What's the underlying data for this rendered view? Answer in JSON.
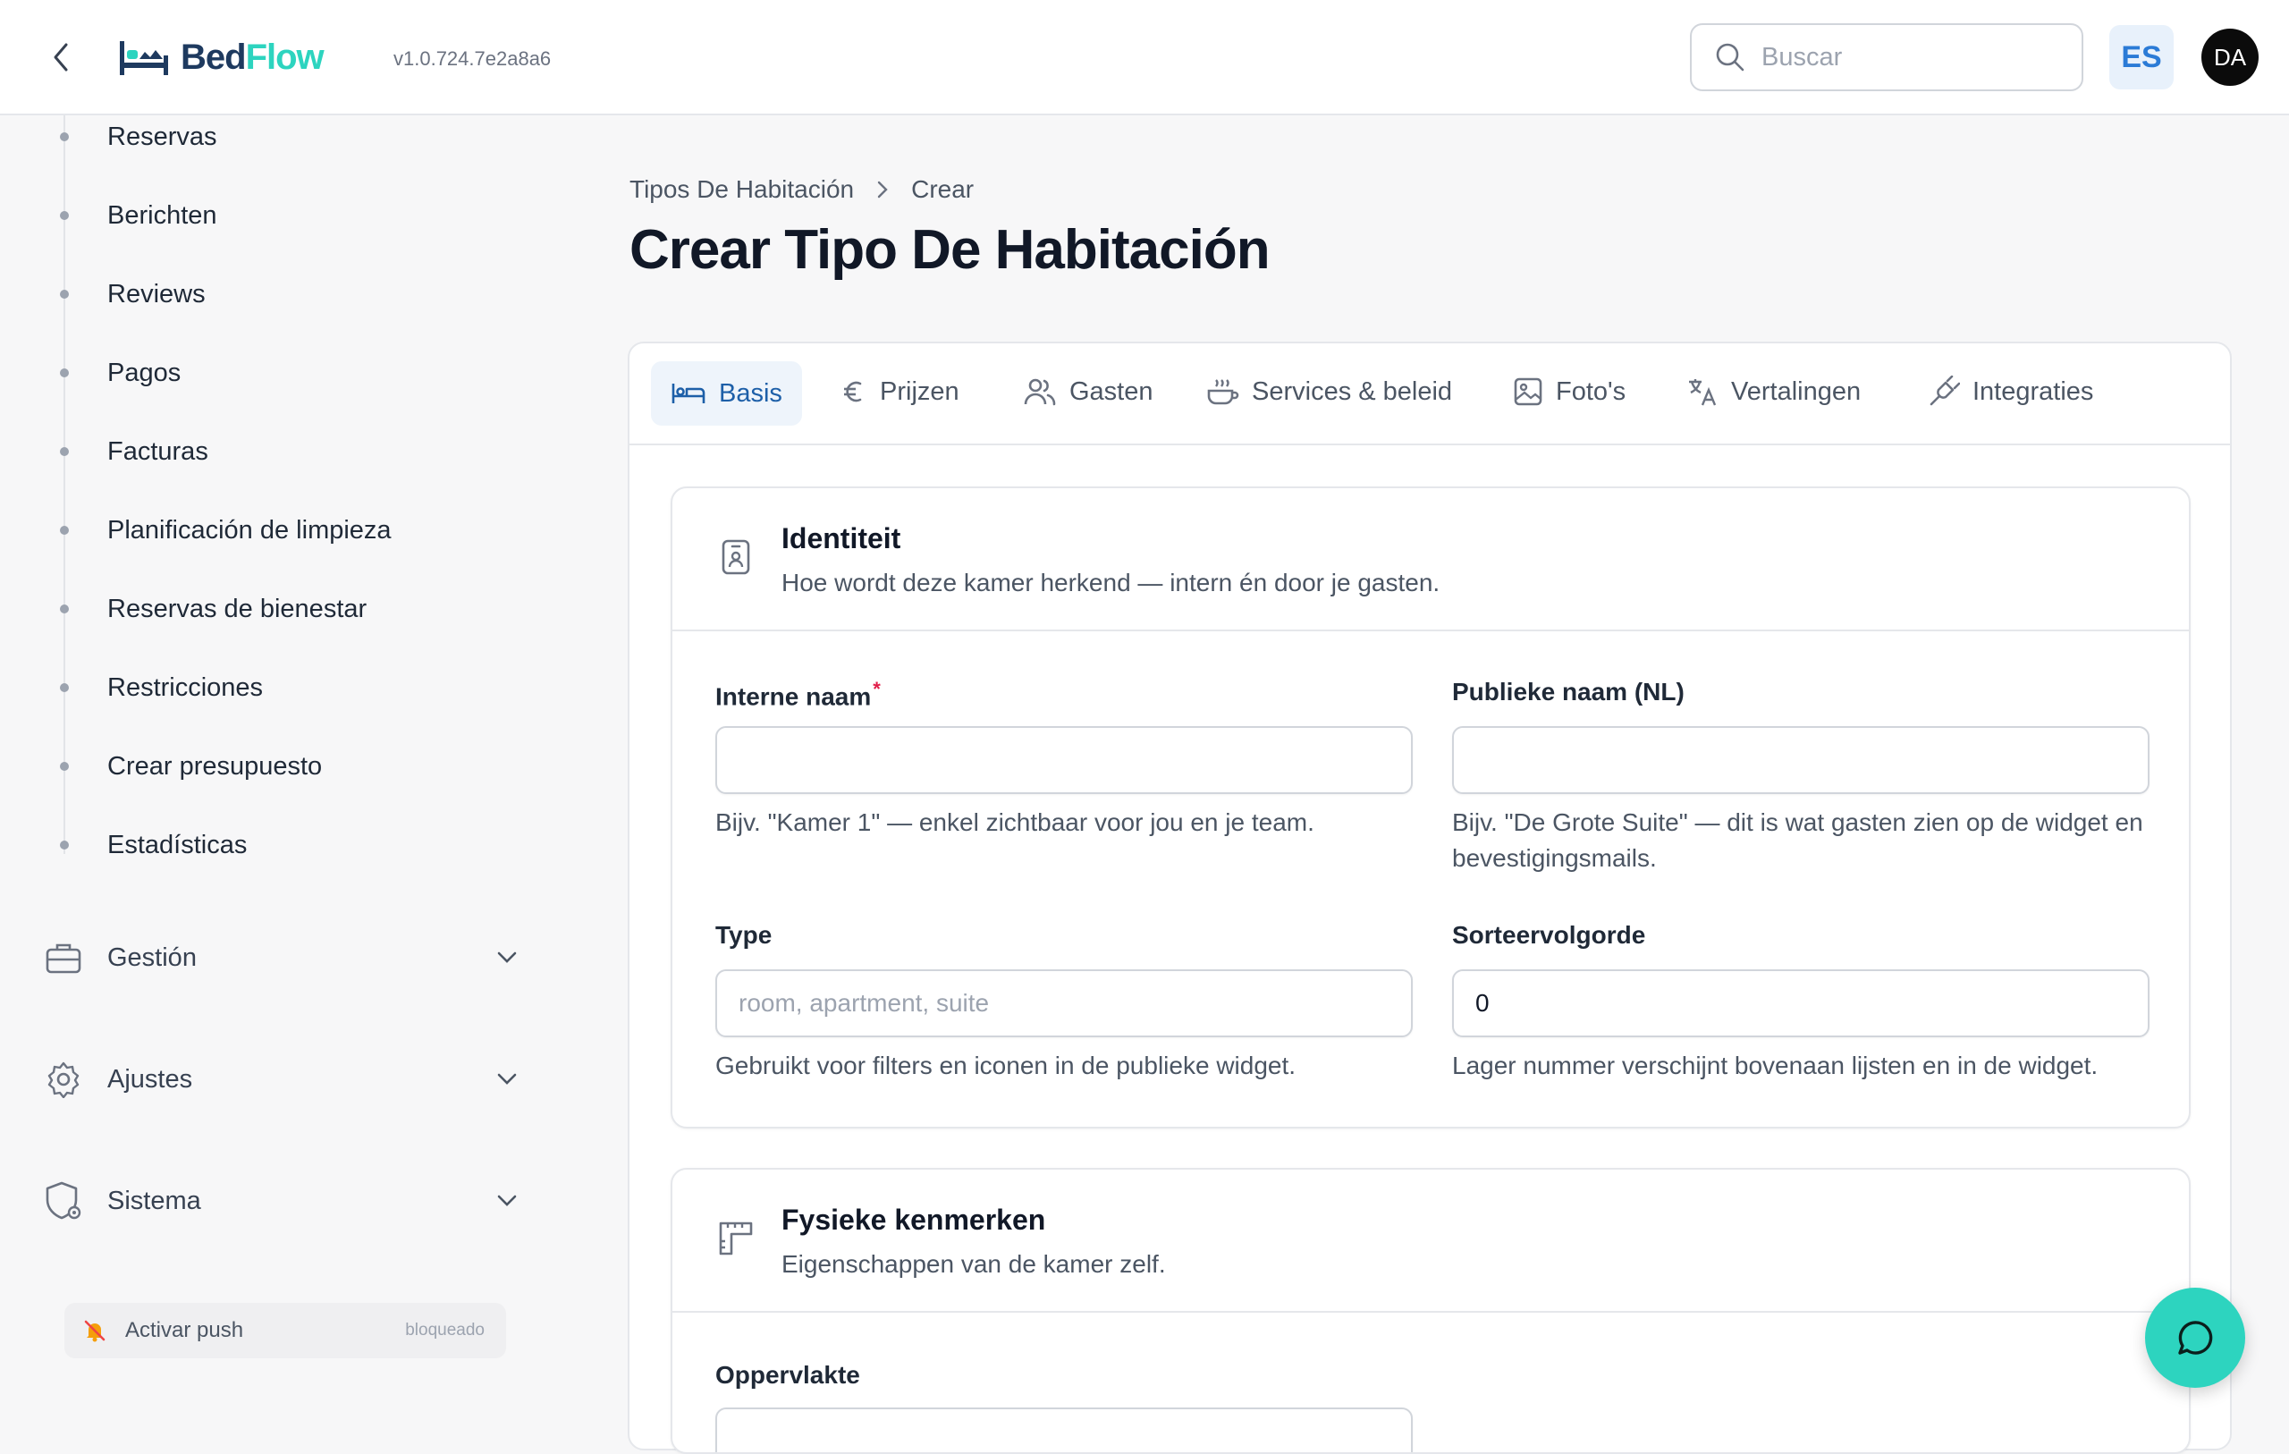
{
  "header": {
    "logo": {
      "part1": "Bed",
      "part2": "Flow"
    },
    "version": "v1.0.724.7e2a8a6",
    "search_placeholder": "Buscar",
    "language": "ES",
    "avatar_initials": "DA"
  },
  "sidebar": {
    "items": [
      {
        "label": "Reservas"
      },
      {
        "label": "Berichten"
      },
      {
        "label": "Reviews"
      },
      {
        "label": "Pagos"
      },
      {
        "label": "Facturas"
      },
      {
        "label": "Planificación de limpieza"
      },
      {
        "label": "Reservas de bienestar"
      },
      {
        "label": "Restricciones"
      },
      {
        "label": "Crear presupuesto"
      },
      {
        "label": "Estadísticas"
      }
    ],
    "groups": [
      {
        "label": "Gestión",
        "icon": "briefcase-icon"
      },
      {
        "label": "Ajustes",
        "icon": "gear-icon"
      },
      {
        "label": "Sistema",
        "icon": "shield-gear-icon"
      }
    ],
    "push": {
      "label": "Activar push",
      "status": "bloqueado"
    }
  },
  "breadcrumb": {
    "parent": "Tipos De Habitación",
    "current": "Crear"
  },
  "page_title": "Crear Tipo De Habitación",
  "tabs": [
    {
      "label": "Basis",
      "icon": "bed-icon",
      "active": true
    },
    {
      "label": "Prijzen",
      "icon": "euro-icon"
    },
    {
      "label": "Gasten",
      "icon": "users-icon"
    },
    {
      "label": "Services & beleid",
      "icon": "coffee-icon"
    },
    {
      "label": "Foto's",
      "icon": "image-icon"
    },
    {
      "label": "Vertalingen",
      "icon": "translate-icon"
    },
    {
      "label": "Integraties",
      "icon": "plug-icon"
    }
  ],
  "identity": {
    "title": "Identiteit",
    "description": "Hoe wordt deze kamer herkend — intern én door je gasten.",
    "internal_name": {
      "label": "Interne naam",
      "required_mark": "*",
      "value": "",
      "help": "Bijv. \"Kamer 1\" — enkel zichtbaar voor jou en je team."
    },
    "public_name": {
      "label": "Publieke naam (NL)",
      "value": "",
      "help": "Bijv. \"De Grote Suite\" — dit is wat gasten zien op de widget en bevestigingsmails."
    },
    "type": {
      "label": "Type",
      "placeholder": "room, apartment, suite",
      "value": "",
      "help": "Gebruikt voor filters en iconen in de publieke widget."
    },
    "sort_order": {
      "label": "Sorteervolgorde",
      "value": "0",
      "help": "Lager nummer verschijnt bovenaan lijsten en in de widget."
    }
  },
  "physical": {
    "title": "Fysieke kenmerken",
    "description": "Eigenschappen van de kamer zelf.",
    "area": {
      "label": "Oppervlakte"
    }
  },
  "colors": {
    "brand_dark": "#1e3a5f",
    "brand_teal": "#2dd4bf",
    "active_tab": "#1d5fa8",
    "required": "#e11d48"
  }
}
